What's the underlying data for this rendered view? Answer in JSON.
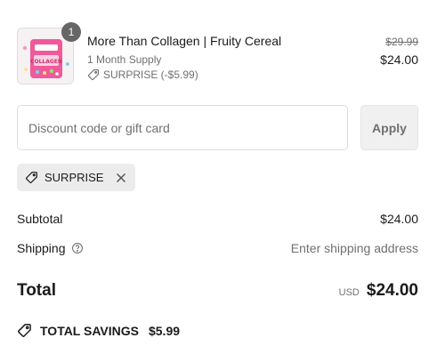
{
  "line_item": {
    "quantity": "1",
    "title": "More Than Collagen | Fruity Cereal",
    "variant": "1 Month Supply",
    "discount_label": "SURPRISE (-$5.99)",
    "original_price": "$29.99",
    "price": "$24.00",
    "thumbnail_icon": "product-image",
    "thumbnail_colors": {
      "pack": "#f05a9a",
      "label": "#ffffff",
      "accent": "#7fd0e8"
    }
  },
  "discount": {
    "placeholder": "Discount code or gift card",
    "value": "",
    "apply_label": "Apply"
  },
  "applied_code": {
    "code": "SURPRISE",
    "tag_icon": "tag-icon",
    "remove_icon": "close-icon"
  },
  "summary": {
    "subtotal_label": "Subtotal",
    "subtotal_value": "$24.00",
    "shipping_label": "Shipping",
    "shipping_value": "Enter shipping address",
    "total_label": "Total",
    "currency": "USD",
    "total_value": "$24.00"
  },
  "savings": {
    "label": "TOTAL SAVINGS",
    "amount": "$5.99"
  }
}
